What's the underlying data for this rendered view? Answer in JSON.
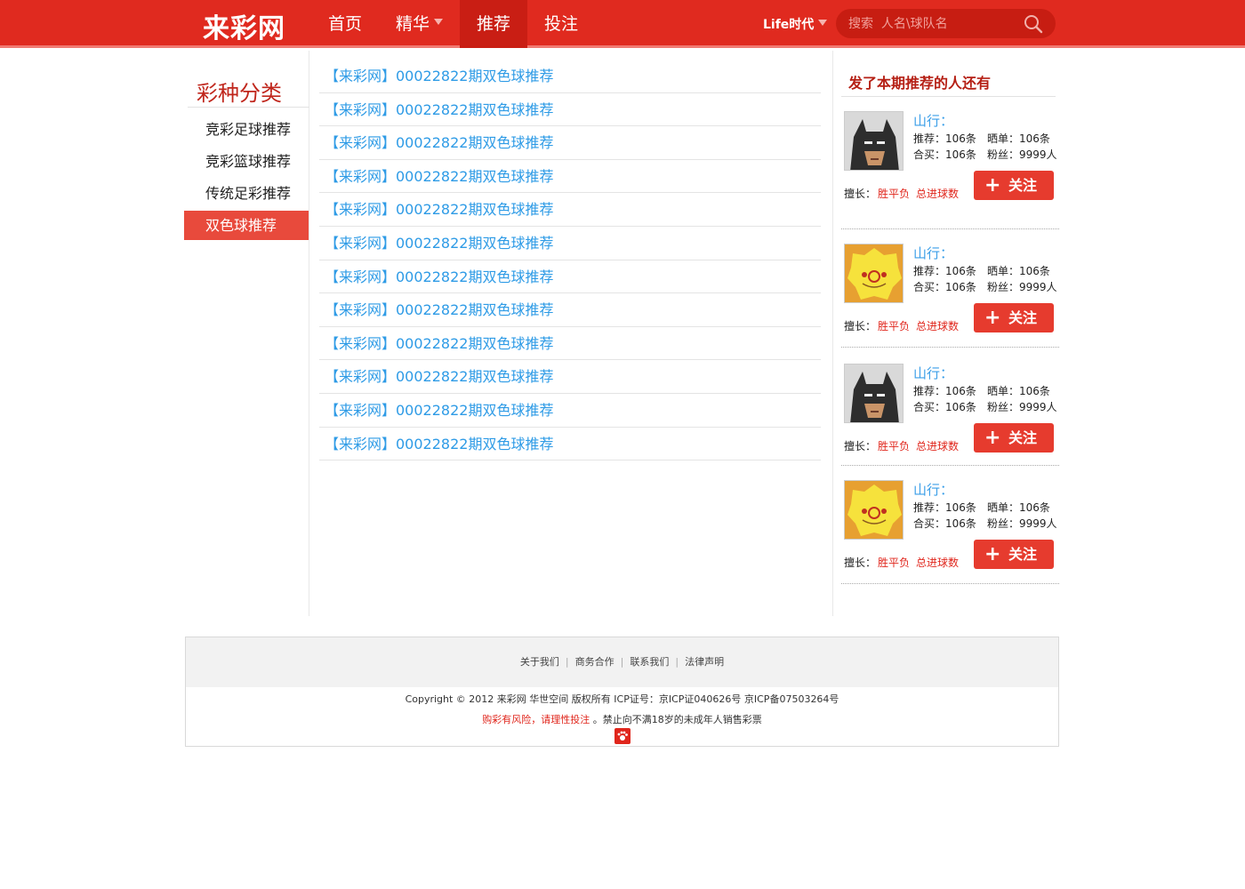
{
  "header": {
    "logo": "来彩网",
    "nav": [
      {
        "label": "首页"
      },
      {
        "label": "精华"
      },
      {
        "label": "推荐"
      },
      {
        "label": "投注"
      }
    ],
    "life_label": "Life时代",
    "search_placeholder": "搜索  人名\\球队名"
  },
  "sidebar": {
    "title": "彩种分类",
    "items": [
      {
        "label": "竞彩足球推荐"
      },
      {
        "label": "竞彩篮球推荐"
      },
      {
        "label": "传统足彩推荐"
      },
      {
        "label": "双色球推荐"
      }
    ]
  },
  "articles": [
    "【来彩网】00022822期双色球推荐",
    "【来彩网】00022822期双色球推荐",
    "【来彩网】00022822期双色球推荐",
    "【来彩网】00022822期双色球推荐",
    "【来彩网】00022822期双色球推荐",
    "【来彩网】00022822期双色球推荐",
    "【来彩网】00022822期双色球推荐",
    "【来彩网】00022822期双色球推荐",
    "【来彩网】00022822期双色球推荐",
    "【来彩网】00022822期双色球推荐",
    "【来彩网】00022822期双色球推荐",
    "【来彩网】00022822期双色球推荐"
  ],
  "right_panel": {
    "title": "发了本期推荐的人还有",
    "users": [
      {
        "name": "山行：",
        "avatar": "batman",
        "recommend": "推荐：106条",
        "share": "晒单：106条",
        "together": "合买：106条",
        "fans": "粉丝：9999人",
        "good_label": "擅长：",
        "tag1": "胜平负",
        "tag2": "总进球数",
        "follow": "关注"
      },
      {
        "name": "山行：",
        "avatar": "yellow-mask",
        "recommend": "推荐：106条",
        "share": "晒单：106条",
        "together": "合买：106条",
        "fans": "粉丝：9999人",
        "good_label": "擅长：",
        "tag1": "胜平负",
        "tag2": "总进球数",
        "follow": "关注"
      },
      {
        "name": "山行：",
        "avatar": "batman",
        "recommend": "推荐：106条",
        "share": "晒单：106条",
        "together": "合买：106条",
        "fans": "粉丝：9999人",
        "good_label": "擅长：",
        "tag1": "胜平负",
        "tag2": "总进球数",
        "follow": "关注"
      },
      {
        "name": "山行：",
        "avatar": "yellow-mask",
        "recommend": "推荐：106条",
        "share": "晒单：106条",
        "together": "合买：106条",
        "fans": "粉丝：9999人",
        "good_label": "擅长：",
        "tag1": "胜平负",
        "tag2": "总进球数",
        "follow": "关注"
      }
    ]
  },
  "footer": {
    "links": [
      "关于我们",
      "商务合作",
      "联系我们",
      "法律声明"
    ],
    "copyright": "Copyright © 2012  来彩网  华世空间  版权所有  ICP证号：京ICP证040626号  京ICP备07503264号",
    "warn_red": "购彩有风险，请理性投注",
    "warn_rest": " 。禁止向不满18岁的未成年人销售彩票"
  },
  "colors": {
    "brand": "#e02a1f",
    "link": "#2e9be6",
    "active": "#e84a3c"
  }
}
